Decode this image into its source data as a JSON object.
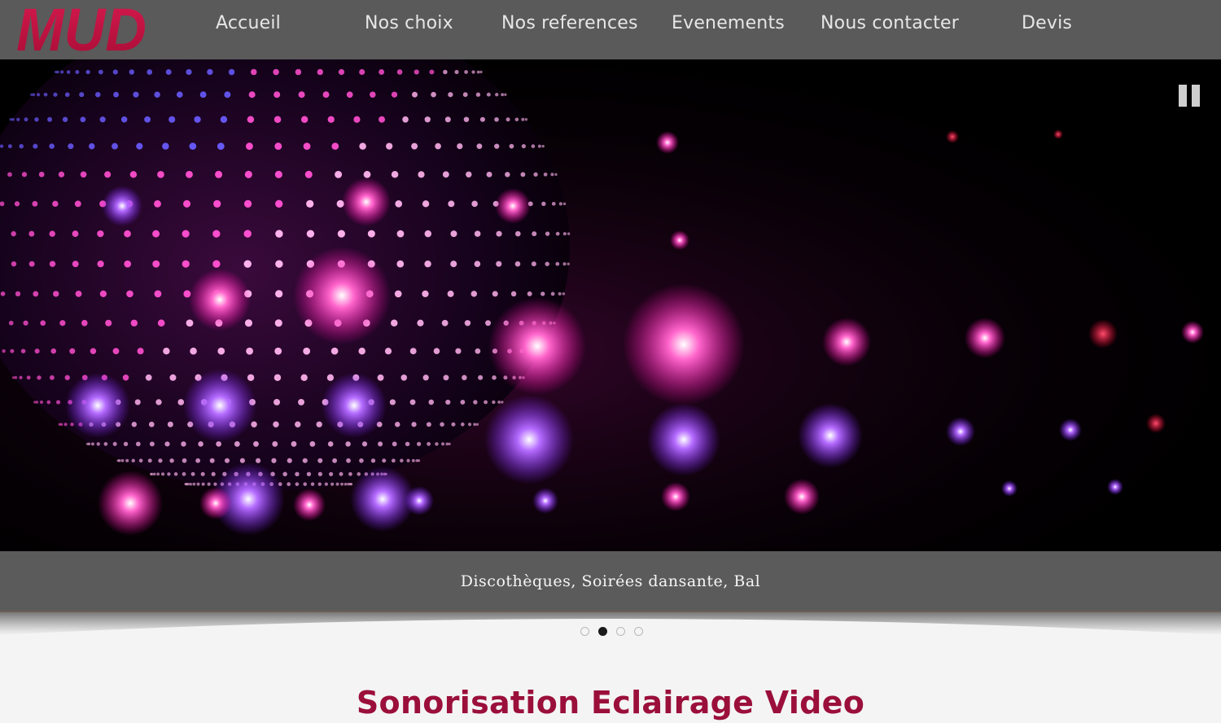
{
  "brand": {
    "logo_text": "MUD",
    "logo_color": "#c0103f"
  },
  "nav": {
    "items": [
      {
        "label": "Accueil"
      },
      {
        "label": "Nos choix"
      },
      {
        "label": "Nos references"
      },
      {
        "label": "Evenements"
      },
      {
        "label": "Nous contacter"
      },
      {
        "label": "Devis"
      }
    ]
  },
  "slider": {
    "controls": {
      "pause_icon": "pause-icon"
    },
    "caption": "Discothèques, Soirées dansante, Bal",
    "dots": {
      "count": 4,
      "active_index": 1
    }
  },
  "main": {
    "title": "Sonorisation Eclairage Video"
  },
  "colors": {
    "header_bg": "#5a5a5a",
    "accent": "#9b0f3b",
    "caption_bg": "#5b5b5b"
  }
}
